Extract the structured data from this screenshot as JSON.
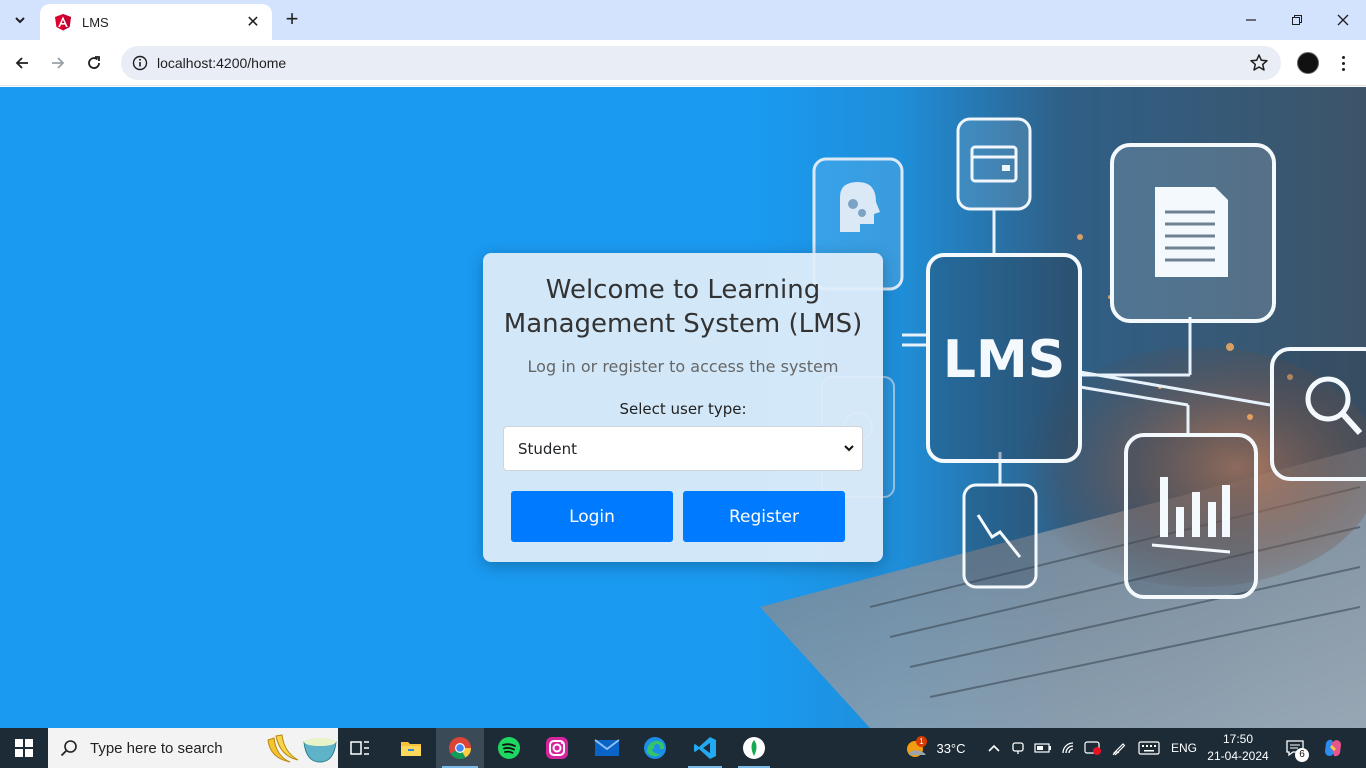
{
  "browser": {
    "tab_title": "LMS",
    "url": "localhost:4200/home"
  },
  "page": {
    "heading": "Welcome to Learning Management System (LMS)",
    "subtitle": "Log in or register to access the system",
    "select_label": "Select user type:",
    "selected_user_type": "Student",
    "login_label": "Login",
    "register_label": "Register",
    "hero_badge_text": "LMS"
  },
  "taskbar": {
    "search_placeholder": "Type here to search",
    "weather_temp": "33°C",
    "weather_badge": "1",
    "language": "ENG",
    "time": "17:50",
    "date": "21-04-2024",
    "notification_count": "6"
  },
  "colors": {
    "accent": "#007bff",
    "page_bg": "#1a9af1",
    "tabstrip": "#d3e3fd",
    "taskbar": "#1c2b36"
  }
}
